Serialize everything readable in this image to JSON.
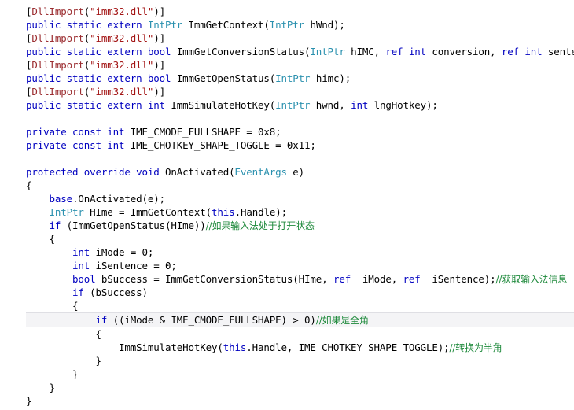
{
  "editor": {
    "language": "C#",
    "background_color": "#ffffff",
    "highlight_row_color": "#f4f4f6",
    "highlight_row_border_color": "#dfdfe4",
    "token_colors": {
      "keyword": "#0000c0",
      "type": "#2b91af",
      "attribute": "#9b2d30",
      "string": "#a31515",
      "comment": "#1f8a3c",
      "plain": "#000000"
    }
  },
  "code": {
    "lines": [
      {
        "id": 1,
        "highlighted": false,
        "text": "[DllImport(\"imm32.dll\")]",
        "tokens": [
          {
            "t": "[",
            "c": "plain"
          },
          {
            "t": "DllImport",
            "c": "attribute"
          },
          {
            "t": "(",
            "c": "plain"
          },
          {
            "t": "\"imm32.dll\"",
            "c": "string"
          },
          {
            "t": ")]",
            "c": "plain"
          }
        ]
      },
      {
        "id": 2,
        "highlighted": false,
        "text": "public static extern IntPtr ImmGetContext(IntPtr hWnd);",
        "tokens": [
          {
            "t": "public static extern ",
            "c": "keyword"
          },
          {
            "t": "IntPtr",
            "c": "type"
          },
          {
            "t": " ImmGetContext(",
            "c": "plain"
          },
          {
            "t": "IntPtr",
            "c": "type"
          },
          {
            "t": " hWnd);",
            "c": "plain"
          }
        ]
      },
      {
        "id": 3,
        "highlighted": false,
        "text": "[DllImport(\"imm32.dll\")]",
        "tokens": [
          {
            "t": "[",
            "c": "plain"
          },
          {
            "t": "DllImport",
            "c": "attribute"
          },
          {
            "t": "(",
            "c": "plain"
          },
          {
            "t": "\"imm32.dll\"",
            "c": "string"
          },
          {
            "t": ")]",
            "c": "plain"
          }
        ]
      },
      {
        "id": 4,
        "highlighted": false,
        "text": "public static extern bool ImmGetConversionStatus(IntPtr hIMC, ref int conversion, ref int sentence);",
        "tokens": [
          {
            "t": "public static extern bool",
            "c": "keyword"
          },
          {
            "t": " ImmGetConversionStatus(",
            "c": "plain"
          },
          {
            "t": "IntPtr",
            "c": "type"
          },
          {
            "t": " hIMC, ",
            "c": "plain"
          },
          {
            "t": "ref int",
            "c": "keyword"
          },
          {
            "t": " conversion, ",
            "c": "plain"
          },
          {
            "t": "ref int",
            "c": "keyword"
          },
          {
            "t": " sentence);",
            "c": "plain"
          }
        ]
      },
      {
        "id": 5,
        "highlighted": false,
        "text": "[DllImport(\"imm32.dll\")]",
        "tokens": [
          {
            "t": "[",
            "c": "plain"
          },
          {
            "t": "DllImport",
            "c": "attribute"
          },
          {
            "t": "(",
            "c": "plain"
          },
          {
            "t": "\"imm32.dll\"",
            "c": "string"
          },
          {
            "t": ")]",
            "c": "plain"
          }
        ]
      },
      {
        "id": 6,
        "highlighted": false,
        "text": "public static extern bool ImmGetOpenStatus(IntPtr himc);",
        "tokens": [
          {
            "t": "public static extern bool",
            "c": "keyword"
          },
          {
            "t": " ImmGetOpenStatus(",
            "c": "plain"
          },
          {
            "t": "IntPtr",
            "c": "type"
          },
          {
            "t": " himc);",
            "c": "plain"
          }
        ]
      },
      {
        "id": 7,
        "highlighted": false,
        "text": "[DllImport(\"imm32.dll\")]",
        "tokens": [
          {
            "t": "[",
            "c": "plain"
          },
          {
            "t": "DllImport",
            "c": "attribute"
          },
          {
            "t": "(",
            "c": "plain"
          },
          {
            "t": "\"imm32.dll\"",
            "c": "string"
          },
          {
            "t": ")]",
            "c": "plain"
          }
        ]
      },
      {
        "id": 8,
        "highlighted": false,
        "text": "public static extern int ImmSimulateHotKey(IntPtr hwnd, int lngHotkey);",
        "tokens": [
          {
            "t": "public static extern int",
            "c": "keyword"
          },
          {
            "t": " ImmSimulateHotKey(",
            "c": "plain"
          },
          {
            "t": "IntPtr",
            "c": "type"
          },
          {
            "t": " hwnd, ",
            "c": "plain"
          },
          {
            "t": "int",
            "c": "keyword"
          },
          {
            "t": " lngHotkey);",
            "c": "plain"
          }
        ]
      },
      {
        "id": 9,
        "highlighted": false,
        "text": "",
        "tokens": []
      },
      {
        "id": 10,
        "highlighted": false,
        "text": "private const int IME_CMODE_FULLSHAPE = 0x8;",
        "tokens": [
          {
            "t": "private const int",
            "c": "keyword"
          },
          {
            "t": " IME_CMODE_FULLSHAPE = 0x8;",
            "c": "plain"
          }
        ]
      },
      {
        "id": 11,
        "highlighted": false,
        "text": "private const int IME_CHOTKEY_SHAPE_TOGGLE = 0x11;",
        "tokens": [
          {
            "t": "private const int",
            "c": "keyword"
          },
          {
            "t": " IME_CHOTKEY_SHAPE_TOGGLE = 0x11;",
            "c": "plain"
          }
        ]
      },
      {
        "id": 12,
        "highlighted": false,
        "text": "",
        "tokens": []
      },
      {
        "id": 13,
        "highlighted": false,
        "text": "protected override void OnActivated(EventArgs e)",
        "tokens": [
          {
            "t": "protected override void",
            "c": "keyword"
          },
          {
            "t": " OnActivated(",
            "c": "plain"
          },
          {
            "t": "EventArgs",
            "c": "type"
          },
          {
            "t": " e)",
            "c": "plain"
          }
        ]
      },
      {
        "id": 14,
        "highlighted": false,
        "text": "{",
        "tokens": [
          {
            "t": "{",
            "c": "plain"
          }
        ]
      },
      {
        "id": 15,
        "highlighted": false,
        "text": "    base.OnActivated(e);",
        "tokens": [
          {
            "t": "    ",
            "c": "plain"
          },
          {
            "t": "base",
            "c": "keyword"
          },
          {
            "t": ".OnActivated(e);",
            "c": "plain"
          }
        ]
      },
      {
        "id": 16,
        "highlighted": false,
        "text": "    IntPtr HIme = ImmGetContext(this.Handle);",
        "tokens": [
          {
            "t": "    ",
            "c": "plain"
          },
          {
            "t": "IntPtr",
            "c": "type"
          },
          {
            "t": " HIme = ImmGetContext(",
            "c": "plain"
          },
          {
            "t": "this",
            "c": "keyword"
          },
          {
            "t": ".Handle);",
            "c": "plain"
          }
        ]
      },
      {
        "id": 17,
        "highlighted": false,
        "text": "    if (ImmGetOpenStatus(HIme))//如果输入法处于打开状态",
        "tokens": [
          {
            "t": "    ",
            "c": "plain"
          },
          {
            "t": "if",
            "c": "keyword"
          },
          {
            "t": " (ImmGetOpenStatus(HIme))",
            "c": "plain"
          },
          {
            "t": "//如果输入法处于打开状态",
            "c": "comment"
          }
        ]
      },
      {
        "id": 18,
        "highlighted": false,
        "text": "    {",
        "tokens": [
          {
            "t": "    {",
            "c": "plain"
          }
        ]
      },
      {
        "id": 19,
        "highlighted": false,
        "text": "        int iMode = 0;",
        "tokens": [
          {
            "t": "        ",
            "c": "plain"
          },
          {
            "t": "int",
            "c": "keyword"
          },
          {
            "t": " iMode = 0;",
            "c": "plain"
          }
        ]
      },
      {
        "id": 20,
        "highlighted": false,
        "text": "        int iSentence = 0;",
        "tokens": [
          {
            "t": "        ",
            "c": "plain"
          },
          {
            "t": "int",
            "c": "keyword"
          },
          {
            "t": " iSentence = 0;",
            "c": "plain"
          }
        ]
      },
      {
        "id": 21,
        "highlighted": false,
        "text": "        bool bSuccess = ImmGetConversionStatus(HIme, ref  iMode, ref  iSentence);//获取输入法信息",
        "tokens": [
          {
            "t": "        ",
            "c": "plain"
          },
          {
            "t": "bool",
            "c": "keyword"
          },
          {
            "t": " bSuccess = ImmGetConversionStatus(HIme, ",
            "c": "plain"
          },
          {
            "t": "ref",
            "c": "keyword"
          },
          {
            "t": "  iMode, ",
            "c": "plain"
          },
          {
            "t": "ref",
            "c": "keyword"
          },
          {
            "t": "  iSentence);",
            "c": "plain"
          },
          {
            "t": "//获取输入法信息",
            "c": "comment"
          }
        ]
      },
      {
        "id": 22,
        "highlighted": false,
        "text": "        if (bSuccess)",
        "tokens": [
          {
            "t": "        ",
            "c": "plain"
          },
          {
            "t": "if",
            "c": "keyword"
          },
          {
            "t": " (bSuccess)",
            "c": "plain"
          }
        ]
      },
      {
        "id": 23,
        "highlighted": false,
        "text": "        {",
        "tokens": [
          {
            "t": "        {",
            "c": "plain"
          }
        ]
      },
      {
        "id": 24,
        "highlighted": true,
        "text": "            if ((iMode & IME_CMODE_FULLSHAPE) > 0)//如果是全角",
        "tokens": [
          {
            "t": "            ",
            "c": "plain"
          },
          {
            "t": "if",
            "c": "keyword"
          },
          {
            "t": " ((iMode & IME_CMODE_FULLSHAPE) > 0)",
            "c": "plain"
          },
          {
            "t": "//如果是全角",
            "c": "comment"
          }
        ]
      },
      {
        "id": 25,
        "highlighted": false,
        "text": "            {",
        "tokens": [
          {
            "t": "            {",
            "c": "plain"
          }
        ]
      },
      {
        "id": 26,
        "highlighted": false,
        "text": "                ImmSimulateHotKey(this.Handle, IME_CHOTKEY_SHAPE_TOGGLE);//转换为半角",
        "tokens": [
          {
            "t": "                ImmSimulateHotKey(",
            "c": "plain"
          },
          {
            "t": "this",
            "c": "keyword"
          },
          {
            "t": ".Handle, IME_CHOTKEY_SHAPE_TOGGLE);",
            "c": "plain"
          },
          {
            "t": "//转换为半角",
            "c": "comment"
          }
        ]
      },
      {
        "id": 27,
        "highlighted": false,
        "text": "            }",
        "tokens": [
          {
            "t": "            }",
            "c": "plain"
          }
        ]
      },
      {
        "id": 28,
        "highlighted": false,
        "text": "        }",
        "tokens": [
          {
            "t": "        }",
            "c": "plain"
          }
        ]
      },
      {
        "id": 29,
        "highlighted": false,
        "text": "    }",
        "tokens": [
          {
            "t": "    }",
            "c": "plain"
          }
        ]
      },
      {
        "id": 30,
        "highlighted": false,
        "text": "}",
        "tokens": [
          {
            "t": "}",
            "c": "plain"
          }
        ]
      }
    ]
  }
}
